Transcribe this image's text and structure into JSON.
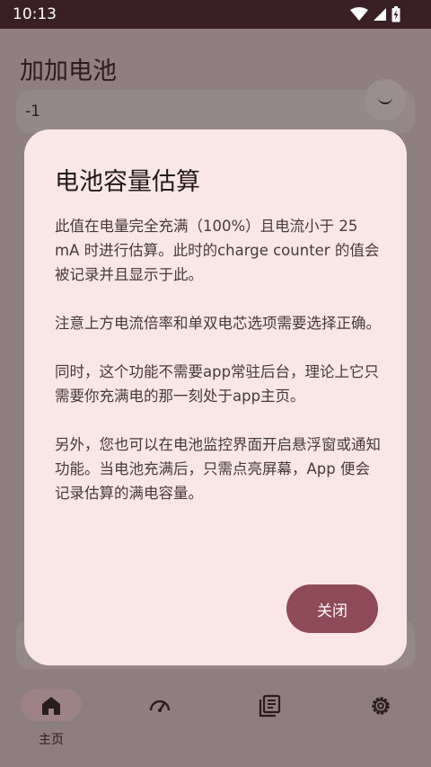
{
  "status_bar": {
    "time": "10:13"
  },
  "app": {
    "title": "加加电池",
    "visible_value": "-1"
  },
  "dialog": {
    "title": "电池容量估算",
    "paragraphs": [
      "此值在电量完全充满（100%）且电流小于 25 mA 时进行估算。此时的charge counter 的值会被记录并且显示于此。",
      "注意上方电流倍率和单双电芯选项需要选择正确。",
      "同时，这个功能不需要app常驻后台，理论上它只需要你充满电的那一刻处于app主页。",
      "另外，您也可以在电池监控界面开启悬浮窗或通知功能。当电池充满后，只需点亮屏幕，App 便会记录估算的满电容量。"
    ],
    "close_label": "关闭"
  },
  "bottom_nav": {
    "items": [
      {
        "label": "主页",
        "icon": "home-icon",
        "selected": true
      },
      {
        "label": "",
        "icon": "speedometer-icon",
        "selected": false
      },
      {
        "label": "",
        "icon": "library-icon",
        "selected": false
      },
      {
        "label": "",
        "icon": "gear-icon",
        "selected": false
      }
    ]
  },
  "colors": {
    "dialog_bg": "#fbe6e6",
    "accent": "#8e4a57",
    "status_bar": "#3b1f27"
  }
}
